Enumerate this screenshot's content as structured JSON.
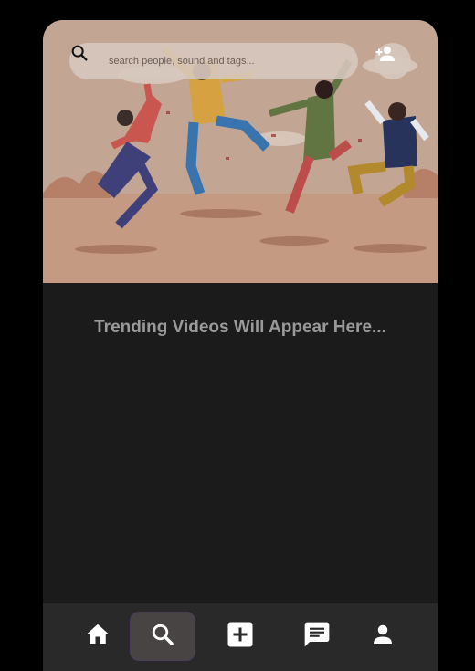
{
  "search": {
    "placeholder": "search people, sound and tags..."
  },
  "main": {
    "message": "Trending Videos Will Appear Here..."
  },
  "nav": {
    "items": [
      {
        "name": "home",
        "icon": "home-icon",
        "active": false
      },
      {
        "name": "search",
        "icon": "search-icon",
        "active": true
      },
      {
        "name": "add",
        "icon": "add-box-icon",
        "active": false
      },
      {
        "name": "messages",
        "icon": "chat-icon",
        "active": false
      },
      {
        "name": "profile",
        "icon": "person-icon",
        "active": false
      }
    ]
  },
  "colors": {
    "background": "#000000",
    "content": "#1b1b1b",
    "nav": "#2a2929",
    "active": "#484444",
    "text": "#9a9a9a"
  }
}
